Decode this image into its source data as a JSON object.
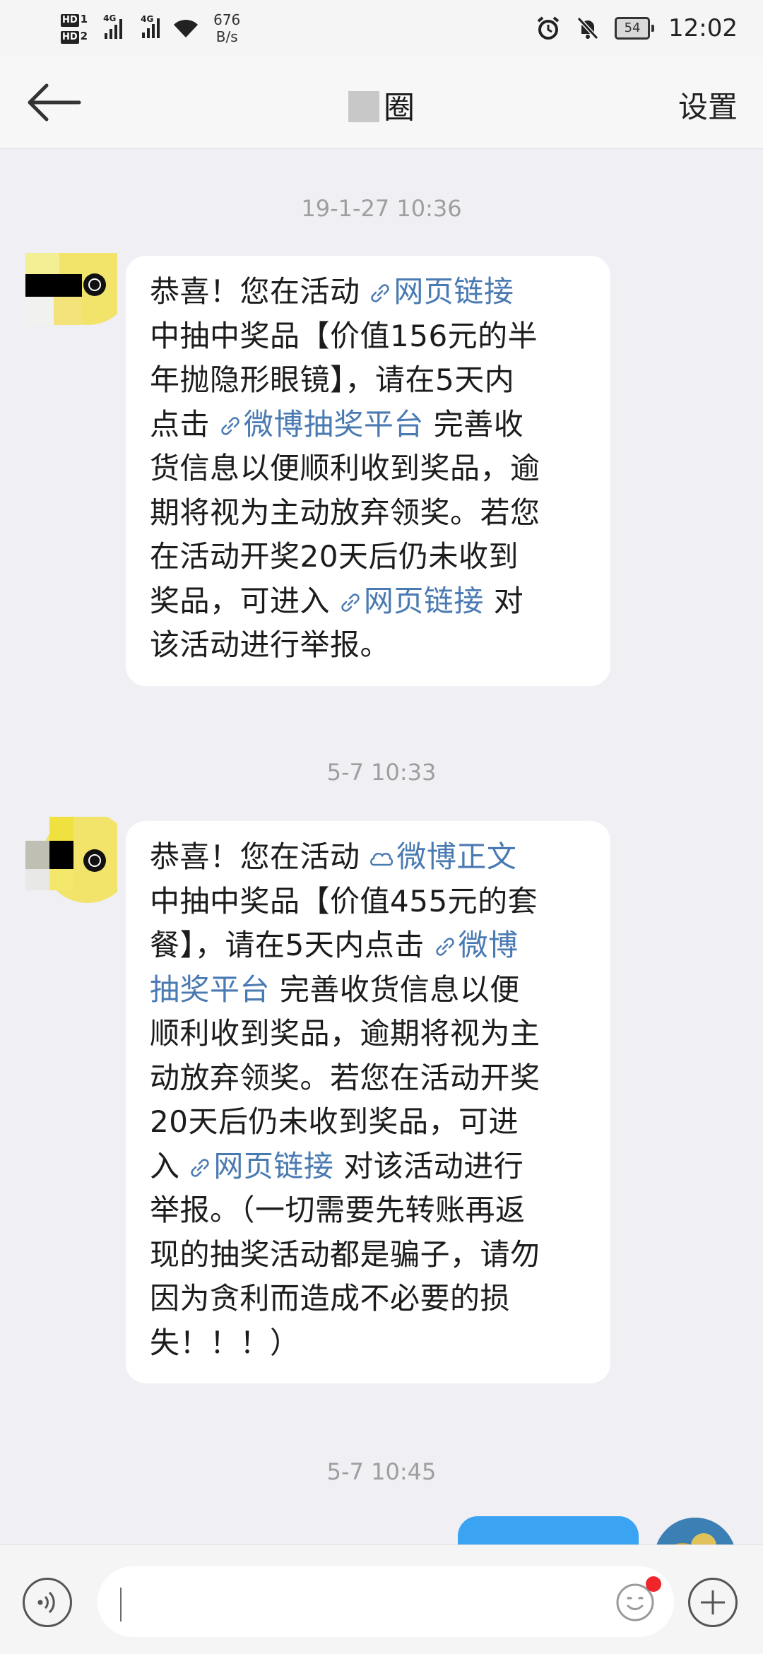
{
  "status_bar": {
    "hd1": "HD",
    "hd1_num": "1",
    "hd2": "HD",
    "hd2_num": "2",
    "net1": "4G",
    "net2": "4G",
    "speed_value": "676",
    "speed_unit": "B/s",
    "battery": "54",
    "time": "12:02"
  },
  "nav": {
    "title": "圈",
    "settings": "设置",
    "back_icon": "arrow-left-icon"
  },
  "chat": {
    "messages": [
      {
        "timestamp": "19-1-27 10:36",
        "lines": [
          {
            "pre": "恭喜！您在活动 ",
            "link": "网页链接",
            "link_icon": "link-icon",
            "post": ""
          },
          {
            "pre": "中抽中奖品【价值156元的半",
            "link": "",
            "post": ""
          },
          {
            "pre": "年抛隐形眼镜】，请在5天内",
            "link": "",
            "post": ""
          },
          {
            "pre": "点击 ",
            "link": "微博抽奖平台",
            "link_icon": "link-icon",
            "post": " 完善收"
          },
          {
            "pre": "货信息以便顺利收到奖品，逾",
            "link": "",
            "post": ""
          },
          {
            "pre": "期将视为主动放弃领奖。若您",
            "link": "",
            "post": ""
          },
          {
            "pre": "在活动开奖20天后仍未收到",
            "link": "",
            "post": ""
          },
          {
            "pre": "奖品，可进入 ",
            "link": "网页链接",
            "link_icon": "link-icon",
            "post": " 对"
          },
          {
            "pre": "该活动进行举报。",
            "link": "",
            "post": ""
          }
        ]
      },
      {
        "timestamp": "5-7 10:33",
        "lines": [
          {
            "pre": "恭喜！您在活动 ",
            "link": "微博正文",
            "link_icon": "weibo-icon",
            "post": ""
          },
          {
            "pre": "中抽中奖品【价值455元的套",
            "link": "",
            "post": ""
          },
          {
            "pre": "餐】，请在5天内点击 ",
            "link": "微博",
            "link_icon": "link-icon",
            "post": ""
          },
          {
            "pre": "",
            "link": "抽奖平台",
            "link_icon": "",
            "post": " 完善收货信息以便"
          },
          {
            "pre": "顺利收到奖品，逾期将视为主",
            "link": "",
            "post": ""
          },
          {
            "pre": "动放弃领奖。若您在活动开奖",
            "link": "",
            "post": ""
          },
          {
            "pre": "20天后仍未收到奖品，可进",
            "link": "",
            "post": ""
          },
          {
            "pre": "入 ",
            "link": "网页链接",
            "link_icon": "link-icon",
            "post": " 对该活动进行"
          },
          {
            "pre": "举报。（一切需要先转账再返",
            "link": "",
            "post": ""
          },
          {
            "pre": "现的抽奖活动都是骗子，请勿",
            "link": "",
            "post": ""
          },
          {
            "pre": "因为贪利而造成不必要的损",
            "link": "",
            "post": ""
          },
          {
            "pre": "失！！！）",
            "link": "",
            "post": ""
          }
        ]
      }
    ],
    "last_timestamp": "5-7 10:45"
  },
  "input_bar": {
    "placeholder": "",
    "voice_icon": "voice-icon",
    "emoji_icon": "emoji-icon",
    "plus_icon": "plus-icon"
  },
  "colors": {
    "link": "#4a7ab2",
    "outgoing_bubble": "#3aa3f2",
    "badge": "#f0252b",
    "background": "#efeff4"
  }
}
